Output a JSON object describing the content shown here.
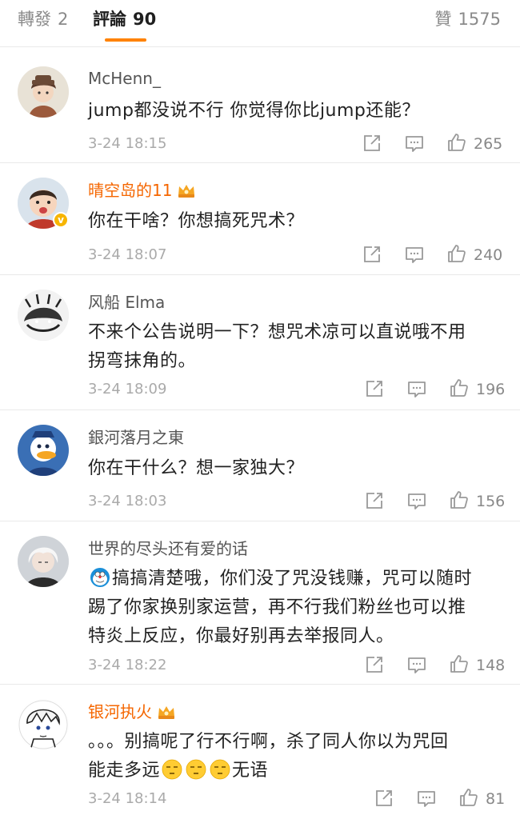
{
  "tabs": {
    "reposts": {
      "label": "轉發",
      "count": "2"
    },
    "comments": {
      "label": "評論",
      "count": "90"
    },
    "likes": {
      "label": "贊",
      "count": "1575"
    }
  },
  "accent_color": "#ff8200",
  "vip_name_color": "#f56600",
  "comments": [
    {
      "user": "McHenn_",
      "vip": false,
      "text": "jump都没说不行 你觉得你比jump还能？",
      "time": "3-24 18:15",
      "likes": "265"
    },
    {
      "user": "晴空岛的11",
      "vip": true,
      "verified": true,
      "text": "你在干啥？你想搞死咒术？",
      "time": "3-24 18:07",
      "likes": "240"
    },
    {
      "user": "风船 Elma",
      "vip": false,
      "text_lines": [
        "不来个公告说明一下？想咒术凉可以直说哦不用",
        "拐弯抹角的。"
      ],
      "time": "3-24 18:09",
      "likes": "196"
    },
    {
      "user": "銀河落月之東",
      "vip": false,
      "text": "你在干什么？想一家独大？",
      "time": "3-24 18:03",
      "likes": "156"
    },
    {
      "user": "世界的尽头还有爱的话",
      "vip": false,
      "emoji": "doraemon-emoji",
      "text_lines": [
        "搞搞清楚哦，你们没了咒没钱赚，咒可以随时",
        "踢了你家换别家运营，再不行我们粉丝也可以推",
        "特炎上反应，你最好别再去举报同人。"
      ],
      "time": "3-24 18:22",
      "likes": "148"
    },
    {
      "user": "银河执火",
      "vip": true,
      "line1": "。。。别搞呢了行不行啊，杀了同人你以为咒回",
      "line2_prefix": "能走多远",
      "line2_emoji": "bored-face-emoji",
      "line2_suffix": "无语",
      "time": "3-24 18:14",
      "likes": "81"
    }
  ]
}
